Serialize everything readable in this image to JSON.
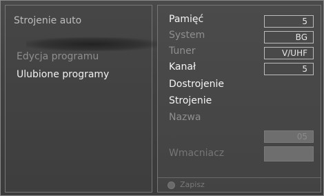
{
  "left_menu": {
    "items": [
      {
        "label": "Strojenie auto"
      },
      {
        "label": "Edycja programu"
      },
      {
        "label": "Ulubione programy"
      }
    ]
  },
  "settings": {
    "rows": [
      {
        "label": "Pamięć",
        "value": "5"
      },
      {
        "label": "System",
        "value": "BG"
      },
      {
        "label": "Tuner",
        "value": "V/UHF"
      },
      {
        "label": "Kanał",
        "value": "5"
      },
      {
        "label": "Dostrojenie"
      },
      {
        "label": "Strojenie"
      },
      {
        "label": "Nazwa"
      },
      {
        "label": "Wmacniacz"
      }
    ],
    "name_value": "05"
  },
  "footer": {
    "save_label": "Zapisz"
  }
}
